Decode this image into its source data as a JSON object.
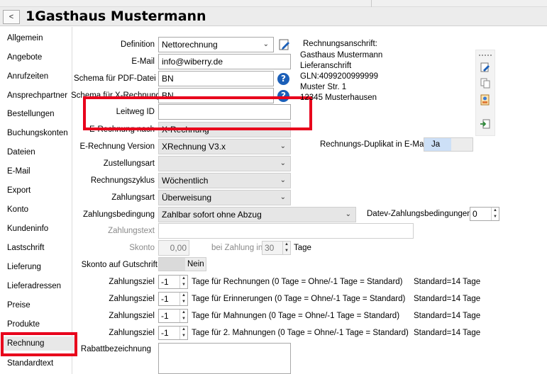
{
  "window": {
    "back_label": "<",
    "title": "1Gasthaus Mustermann"
  },
  "sidebar": {
    "items": [
      "Allgemein",
      "Angebote",
      "Anrufzeiten",
      "Ansprechpartner",
      "Bestellungen",
      "Buchungskonten",
      "Dateien",
      "E-Mail",
      "Export",
      "Konto",
      "Kundeninfo",
      "Lastschrift",
      "Lieferung",
      "Lieferadressen",
      "Preise",
      "Produkte",
      "Rechnung",
      "Standardtext"
    ],
    "active": "Rechnung"
  },
  "form": {
    "definition": {
      "label": "Definition",
      "value": "Nettorechnung"
    },
    "email": {
      "label": "E-Mail",
      "value": "info@wiberry.de"
    },
    "schema_pdf": {
      "label": "Schema für PDF-Datei",
      "value": "BN"
    },
    "schema_xr": {
      "label": "Schema für X-Rechnung",
      "value": "BN"
    },
    "leitweg": {
      "label": "Leitweg ID",
      "value": ""
    },
    "erechnung_nach": {
      "label": "E-Rechnung nach",
      "value": "X-Rechnung"
    },
    "erechnung_version": {
      "label": "E-Rechnung Version",
      "value": "XRechnung V3.x"
    },
    "zustellungsart": {
      "label": "Zustellungsart",
      "value": ""
    },
    "rechnungszyklus": {
      "label": "Rechnungszyklus",
      "value": "Wöchentlich"
    },
    "zahlungsart": {
      "label": "Zahlungsart",
      "value": "Überweisung"
    },
    "zahlungsbedingung": {
      "label": "Zahlungsbedingung",
      "value": "Zahlbar sofort ohne Abzug"
    },
    "datev": {
      "label": "Datev-Zahlungsbedingungen",
      "value": "0"
    },
    "zahlungstext": {
      "label": "Zahlungstext",
      "value": ""
    },
    "skonto": {
      "label": "Skonto",
      "value": "0,00",
      "bei_label": "bei Zahlung in",
      "days": "30",
      "days_label": "Tage"
    },
    "skonto_gutschrift": {
      "label": "Skonto auf Gutschrift",
      "value": "Nein"
    },
    "zahlungsziel_rows": [
      {
        "label": "Zahlungsziel",
        "value": "-1",
        "desc": "Tage für Rechnungen (0 Tage = Ohne/-1 Tage = Standard)",
        "std": "Standard=14 Tage"
      },
      {
        "label": "Zahlungsziel",
        "value": "-1",
        "desc": "Tage für Erinnerungen (0 Tage = Ohne/-1 Tage = Standard)",
        "std": "Standard=14 Tage"
      },
      {
        "label": "Zahlungsziel",
        "value": "-1",
        "desc": "Tage für Mahnungen (0 Tage = Ohne/-1 Tage = Standard)",
        "std": "Standard=14 Tage"
      },
      {
        "label": "Zahlungsziel",
        "value": "-1",
        "desc": "Tage für 2. Mahnungen (0 Tage = Ohne/-1 Tage = Standard)",
        "std": "Standard=14 Tage"
      }
    ],
    "rabatt": {
      "label": "Rabattbezeichnung",
      "value": ""
    }
  },
  "address": {
    "heading": "Rechnungsanschrift:",
    "lines": [
      "Gasthaus Mustermann",
      "Lieferanschrift",
      "GLN:4099200999999",
      "Muster Str. 1",
      "12345 Musterhausen"
    ]
  },
  "duplikat": {
    "label": "Rechnungs-Duplikat in E-Mail",
    "value": "Ja"
  },
  "colors": {
    "highlight": "#e8001c",
    "help": "#1b5fb8",
    "toggle_on": "#cde0f7"
  }
}
